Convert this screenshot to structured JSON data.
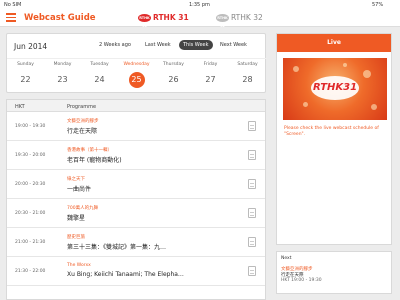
{
  "status": {
    "carrier": "No SIM",
    "time": "1:35 pm",
    "battery": "57%"
  },
  "header": {
    "title": "Webcast Guide",
    "channel1_logo": "RTHK 31",
    "channel1_label": "RTHK 31",
    "channel2_logo": "RTHK 32",
    "channel2_label": "RTHK 32"
  },
  "calendar": {
    "month": "Jun 2014",
    "week_prev2": "2 Weeks ago",
    "week_last": "Last Week",
    "week_this": "This Week",
    "week_next": "Next Week",
    "days": [
      {
        "name": "Sunday",
        "date": "22"
      },
      {
        "name": "Monday",
        "date": "23"
      },
      {
        "name": "Tuesday",
        "date": "24"
      },
      {
        "name": "Wednesday",
        "date": "25"
      },
      {
        "name": "Thursday",
        "date": "26"
      },
      {
        "name": "Friday",
        "date": "27"
      },
      {
        "name": "Saturday",
        "date": "28"
      }
    ],
    "selected_index": 3
  },
  "programme": {
    "col_time": "HKT",
    "col_programme": "Programme",
    "rows": [
      {
        "time": "19:00 - 19:30",
        "sub": "文藝亞洲的腳步",
        "main": "行走在天際"
      },
      {
        "time": "19:30 - 20:00",
        "sub": "香港故事（第十一輯）",
        "main": "老百年 (寵物商動化)"
      },
      {
        "time": "20:00 - 20:30",
        "sub": "綠之天下",
        "main": "一曲尚件"
      },
      {
        "time": "20:30 - 21:00",
        "sub": "700萬人的九舞",
        "main": "魏擎星"
      },
      {
        "time": "21:00 - 21:30",
        "sub": "歷史巨旅",
        "main": "第三十三集：《雙城記》第一集：九…"
      },
      {
        "time": "21:30 - 22:00",
        "sub": "The Worxx",
        "main": "Xu Bing; Keiichi Tanaami; The Elepha…"
      }
    ]
  },
  "live": {
    "heading": "Live",
    "image_logo": "RTHK31",
    "message": "Please check the live webcast schedule of \"Screen\"."
  },
  "next": {
    "label": "Next",
    "sub": "文藝亞洲的腳步",
    "main": "行走在天際",
    "time": "HKT 19:00 - 19:30"
  },
  "colors": {
    "accent": "#ef5a24",
    "channel_red": "#e02a2a"
  }
}
